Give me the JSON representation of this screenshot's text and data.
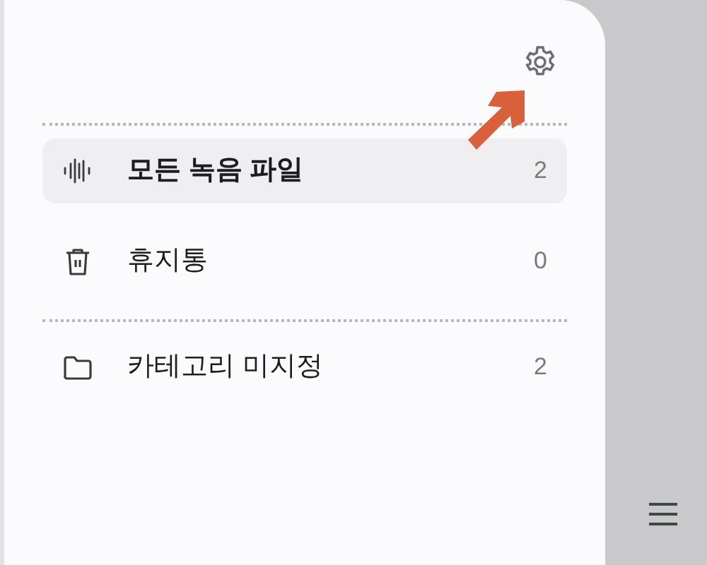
{
  "sections": [
    {
      "items": [
        {
          "kind": "waveform",
          "label": "모든 녹음 파일",
          "count": "2",
          "selected": true
        },
        {
          "kind": "trash",
          "label": "휴지통",
          "count": "0",
          "selected": false
        }
      ]
    },
    {
      "items": [
        {
          "kind": "folder",
          "label": "카테고리 미지정",
          "count": "2",
          "selected": false
        }
      ]
    }
  ]
}
